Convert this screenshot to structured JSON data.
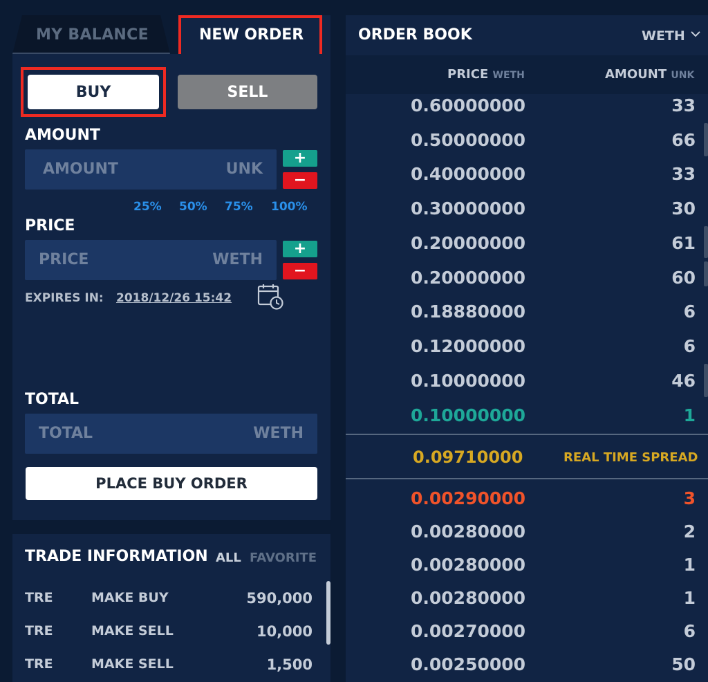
{
  "tabs": {
    "my_balance": "MY BALANCE",
    "new_order": "NEW ORDER"
  },
  "order_form": {
    "buy_label": "BUY",
    "sell_label": "SELL",
    "amount_label": "AMOUNT",
    "amount_placeholder": "AMOUNT",
    "amount_unit": "UNK",
    "percentages": [
      "25%",
      "50%",
      "75%",
      "100%"
    ],
    "price_label": "PRICE",
    "price_placeholder": "PRICE",
    "price_unit": "WETH",
    "plus_symbol": "+",
    "minus_symbol": "−",
    "expires_label": "EXPIRES IN:",
    "expires_value": "2018/12/26 15:42",
    "total_label": "TOTAL",
    "total_placeholder": "TOTAL",
    "total_unit": "WETH",
    "place_order_label": "PLACE BUY ORDER"
  },
  "trade_info": {
    "title": "TRADE INFORMATION",
    "filter_all": "ALL",
    "filter_favorite": "FAVORITE",
    "rows": [
      {
        "token": "TRE",
        "type": "MAKE BUY",
        "amount": "590,000"
      },
      {
        "token": "TRE",
        "type": "MAKE SELL",
        "amount": "10,000"
      },
      {
        "token": "TRE",
        "type": "MAKE SELL",
        "amount": "1,500"
      }
    ]
  },
  "order_book": {
    "title": "ORDER BOOK",
    "token": "WETH",
    "price_header": "PRICE",
    "price_header_unit": "WETH",
    "amount_header": "AMOUNT",
    "amount_header_unit": "UNK",
    "asks": [
      {
        "price": "0.60000000",
        "amount": "33"
      },
      {
        "price": "0.50000000",
        "amount": "66"
      },
      {
        "price": "0.40000000",
        "amount": "33"
      },
      {
        "price": "0.30000000",
        "amount": "30"
      },
      {
        "price": "0.20000000",
        "amount": "61"
      },
      {
        "price": "0.20000000",
        "amount": "60"
      },
      {
        "price": "0.18880000",
        "amount": "6"
      },
      {
        "price": "0.12000000",
        "amount": "6"
      },
      {
        "price": "0.10000000",
        "amount": "46"
      },
      {
        "price": "0.10000000",
        "amount": "1"
      }
    ],
    "spread_price": "0.09710000",
    "spread_label": "REAL TIME SPREAD",
    "bids": [
      {
        "price": "0.00290000",
        "amount": "3"
      },
      {
        "price": "0.00280000",
        "amount": "2"
      },
      {
        "price": "0.00280000",
        "amount": "1"
      },
      {
        "price": "0.00280000",
        "amount": "1"
      },
      {
        "price": "0.00270000",
        "amount": "6"
      },
      {
        "price": "0.00250000",
        "amount": "50"
      }
    ],
    "colors": {
      "best_ask": "#1ea898",
      "best_bid": "#f0532a",
      "spread": "#d7a822"
    }
  }
}
